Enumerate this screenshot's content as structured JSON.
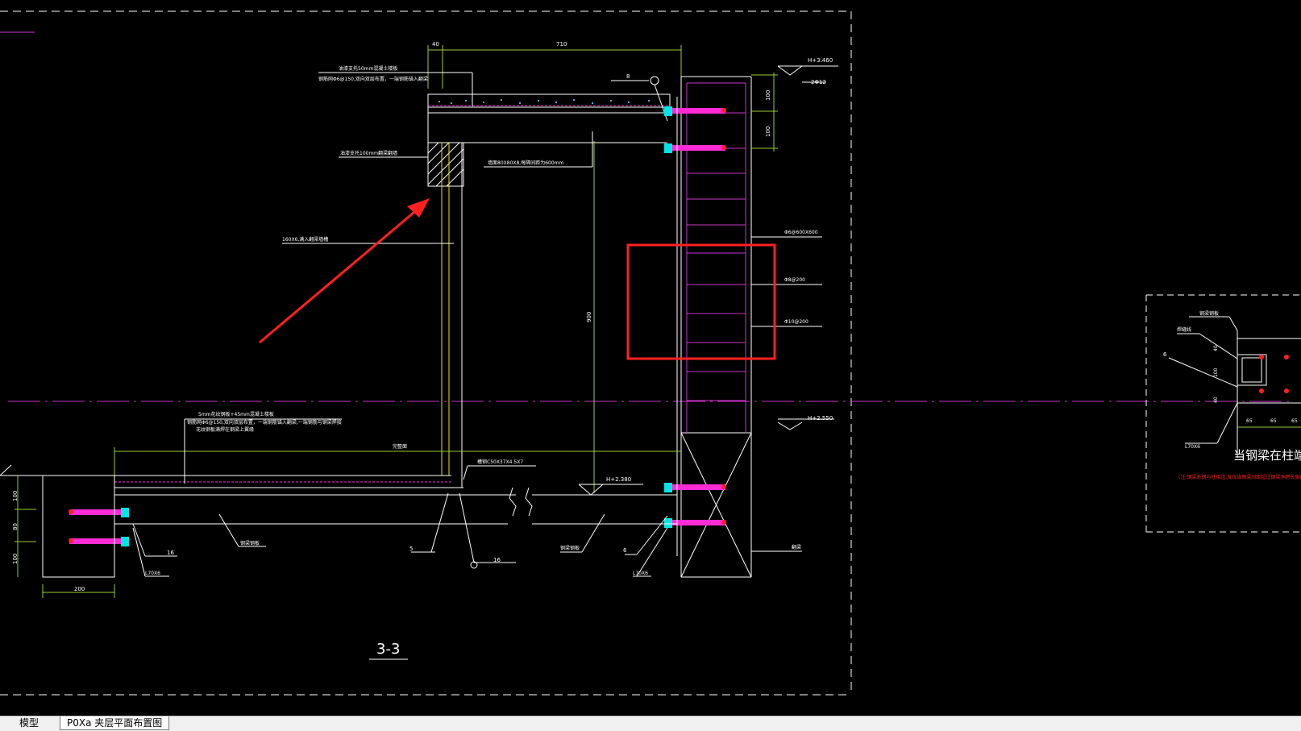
{
  "tabs": [
    {
      "label": "模型"
    },
    {
      "label": "P0Xa 夹层平面布置图"
    }
  ],
  "colors": {
    "background": "#000000",
    "line": "#ffffff",
    "dim": "#9acd32",
    "magenta": "#cc33cc",
    "rebar": "#ff2bd6",
    "annotation_red": "#ff2020",
    "tab_bg": "#f0f0f0"
  },
  "drawing": {
    "section_title": "3-3",
    "dims": {
      "d40": "40",
      "d710": "710",
      "d900": "900",
      "d100a": "100",
      "d100b": "100",
      "d100c": "100",
      "d80": "80",
      "d100d": "100",
      "d200": "200"
    },
    "elevations": {
      "e1": "H+3.460",
      "e2": "H+2.550",
      "e3": "H+2.380"
    },
    "labels": {
      "l_rebar_top": "2Φ12",
      "l_8": "8",
      "l_note1a": "油漆支托50mm混凝土楼板",
      "l_note1b": "钢筋网Φ6@150,双向双层布置，一端钢筋锚入翻梁",
      "l_note2": "油漆支托100mm翻梁翻墙",
      "l_steel": "墙面80X80X8,每隔间距为600mm",
      "l_160": "160X6,满入翻梁墙槽",
      "l_phi6": "Φ6@600X600",
      "l_phi8": "Φ8@200",
      "l_phi10": "Φ10@200",
      "l_note3a": "5mm花纹钢板+45mm混凝土楼板",
      "l_note3b": "钢筋网Φ6@150,双向双层布置，一端钢筋锚入翻梁,一端钢筋与钢梁焊接",
      "l_note3c": "花纹钢板满焊在钢梁上翼缘",
      "l_level": "完整面",
      "l_channel": "槽钢C50X37X4.5X7",
      "l_beam1": "钢梁钢板",
      "l_beam2": "钢梁钢板",
      "l_5": "5",
      "l_16a": "16",
      "l_16b": "16",
      "l_6a": "6",
      "l_angle1": "L70X6",
      "l_angle2": "L70X6",
      "l_column": "翻梁"
    },
    "detail": {
      "l_a": "钢梁钢板",
      "l_b": "焊缝线",
      "l_6": "6",
      "l_40a": "40",
      "l_100": "100",
      "l_40b": "40",
      "l_65a": "65",
      "l_65b": "65",
      "l_65c": "65",
      "l_angle": "L70X6",
      "title": "当钢梁在柱端时",
      "note": "(注:钢梁系钢与柱相连,发现当钢梁间距超过钢梁净跨长度),其平面做法)"
    }
  }
}
